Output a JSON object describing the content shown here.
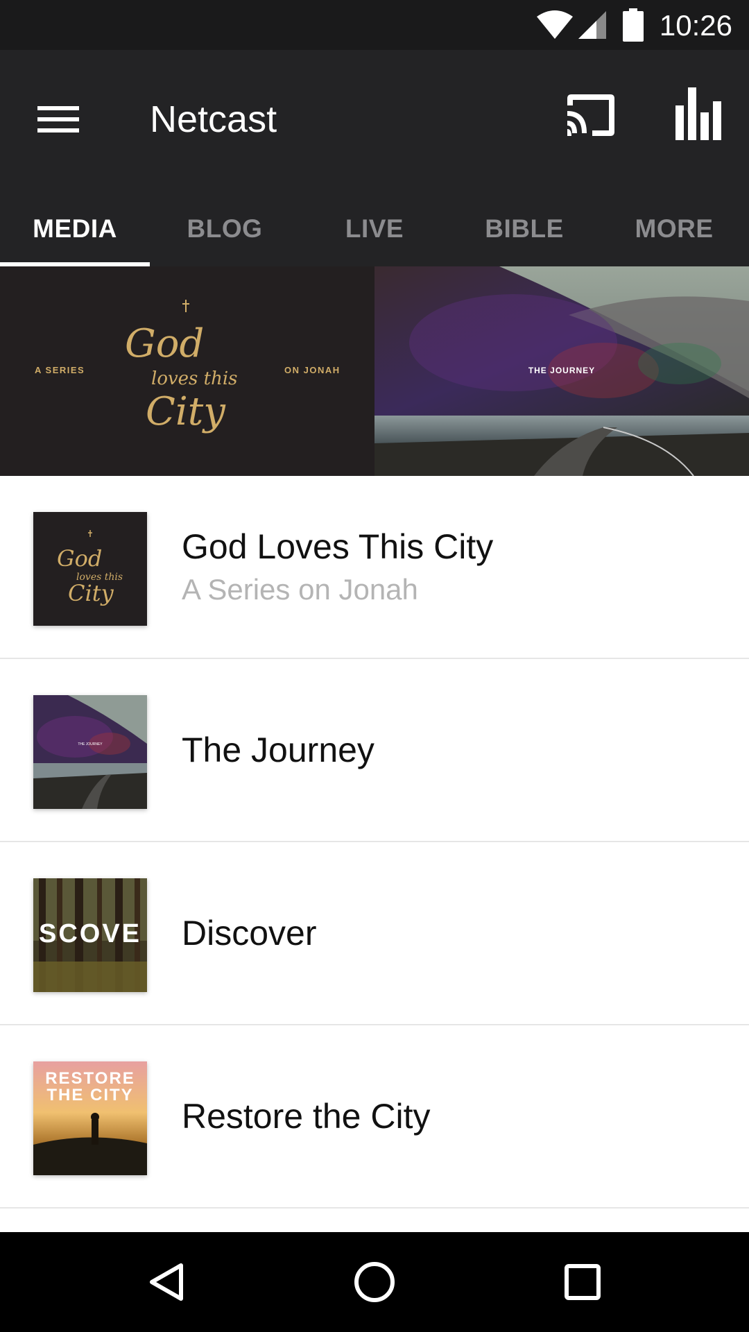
{
  "status_bar": {
    "time": "10:26",
    "icons": [
      "wifi-icon",
      "cell-signal-icon",
      "battery-icon"
    ]
  },
  "app_bar": {
    "title": "Netcast",
    "icons": [
      "menu-icon",
      "cast-icon",
      "stats-icon"
    ]
  },
  "tabs": [
    {
      "label": "MEDIA",
      "active": true
    },
    {
      "label": "BLOG",
      "active": false
    },
    {
      "label": "LIVE",
      "active": false
    },
    {
      "label": "BIBLE",
      "active": false
    },
    {
      "label": "MORE",
      "active": false
    }
  ],
  "banner": {
    "left": {
      "left_text": "A SERIES",
      "script_line_1": "God",
      "script_line_2": "loves this",
      "script_line_3": "City",
      "right_text": "ON JONAH"
    },
    "right": {
      "overlay_text": "THE JOURNEY"
    }
  },
  "list": {
    "items": [
      {
        "title": "God Loves This City",
        "subtitle": "A Series on Jonah",
        "thumb_text": [
          "God",
          "loves this",
          "City"
        ]
      },
      {
        "title": "The Journey",
        "subtitle": "",
        "thumb_text": [
          "THE JOURNEY"
        ]
      },
      {
        "title": "Discover",
        "subtitle": "",
        "thumb_text": [
          "SCOVE"
        ]
      },
      {
        "title": "Restore the City",
        "subtitle": "",
        "thumb_text": [
          "RESTORE",
          "THE CITY"
        ]
      }
    ]
  },
  "nav_bar": {
    "icons": [
      "back-icon",
      "home-icon",
      "recents-icon"
    ]
  },
  "colors": {
    "status_bar_bg": "#1a1a1b",
    "app_bar_bg": "#232325",
    "tab_inactive": "#8c8c8f",
    "tab_active": "#ffffff",
    "gold": "#d1ad68"
  }
}
